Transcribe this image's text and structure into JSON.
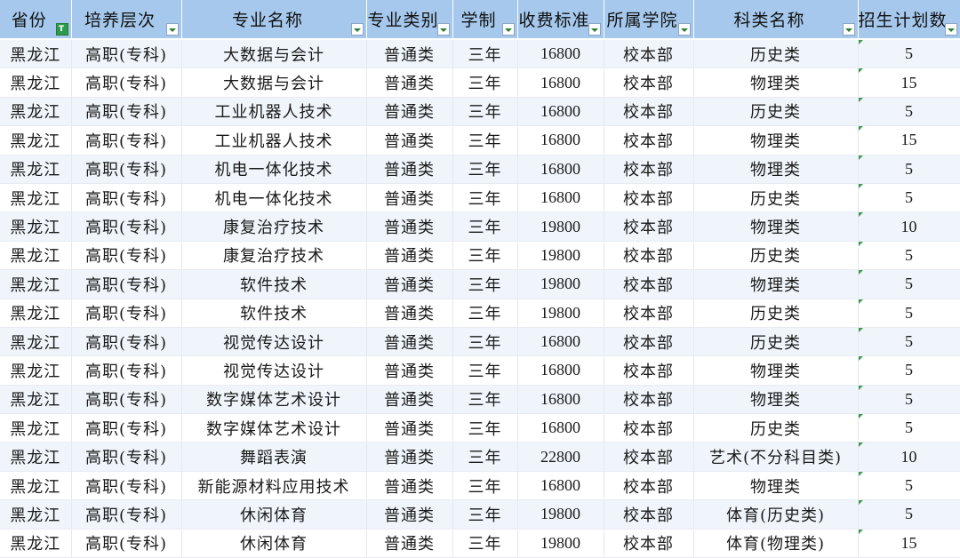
{
  "headers": [
    {
      "label": "省份",
      "filter": "active"
    },
    {
      "label": "培养层次",
      "filter": "dropdown"
    },
    {
      "label": "专业名称",
      "filter": "dropdown"
    },
    {
      "label": "专业类别",
      "filter": "dropdown"
    },
    {
      "label": "学制",
      "filter": "dropdown"
    },
    {
      "label": "收费标准",
      "filter": "dropdown"
    },
    {
      "label": "所属学院",
      "filter": "dropdown"
    },
    {
      "label": "科类名称",
      "filter": "dropdown"
    },
    {
      "label": "招生计划数",
      "filter": "dropdown"
    }
  ],
  "rows": [
    [
      "黑龙江",
      "高职(专科)",
      "大数据与会计",
      "普通类",
      "三年",
      "16800",
      "校本部",
      "历史类",
      "5"
    ],
    [
      "黑龙江",
      "高职(专科)",
      "大数据与会计",
      "普通类",
      "三年",
      "16800",
      "校本部",
      "物理类",
      "15"
    ],
    [
      "黑龙江",
      "高职(专科)",
      "工业机器人技术",
      "普通类",
      "三年",
      "16800",
      "校本部",
      "历史类",
      "5"
    ],
    [
      "黑龙江",
      "高职(专科)",
      "工业机器人技术",
      "普通类",
      "三年",
      "16800",
      "校本部",
      "物理类",
      "15"
    ],
    [
      "黑龙江",
      "高职(专科)",
      "机电一体化技术",
      "普通类",
      "三年",
      "16800",
      "校本部",
      "物理类",
      "5"
    ],
    [
      "黑龙江",
      "高职(专科)",
      "机电一体化技术",
      "普通类",
      "三年",
      "16800",
      "校本部",
      "历史类",
      "5"
    ],
    [
      "黑龙江",
      "高职(专科)",
      "康复治疗技术",
      "普通类",
      "三年",
      "19800",
      "校本部",
      "物理类",
      "10"
    ],
    [
      "黑龙江",
      "高职(专科)",
      "康复治疗技术",
      "普通类",
      "三年",
      "19800",
      "校本部",
      "历史类",
      "5"
    ],
    [
      "黑龙江",
      "高职(专科)",
      "软件技术",
      "普通类",
      "三年",
      "19800",
      "校本部",
      "物理类",
      "5"
    ],
    [
      "黑龙江",
      "高职(专科)",
      "软件技术",
      "普通类",
      "三年",
      "19800",
      "校本部",
      "历史类",
      "5"
    ],
    [
      "黑龙江",
      "高职(专科)",
      "视觉传达设计",
      "普通类",
      "三年",
      "16800",
      "校本部",
      "历史类",
      "5"
    ],
    [
      "黑龙江",
      "高职(专科)",
      "视觉传达设计",
      "普通类",
      "三年",
      "16800",
      "校本部",
      "物理类",
      "5"
    ],
    [
      "黑龙江",
      "高职(专科)",
      "数字媒体艺术设计",
      "普通类",
      "三年",
      "16800",
      "校本部",
      "物理类",
      "5"
    ],
    [
      "黑龙江",
      "高职(专科)",
      "数字媒体艺术设计",
      "普通类",
      "三年",
      "16800",
      "校本部",
      "历史类",
      "5"
    ],
    [
      "黑龙江",
      "高职(专科)",
      "舞蹈表演",
      "普通类",
      "三年",
      "22800",
      "校本部",
      "艺术(不分科目类)",
      "10"
    ],
    [
      "黑龙江",
      "高职(专科)",
      "新能源材料应用技术",
      "普通类",
      "三年",
      "16800",
      "校本部",
      "物理类",
      "5"
    ],
    [
      "黑龙江",
      "高职(专科)",
      "休闲体育",
      "普通类",
      "三年",
      "19800",
      "校本部",
      "体育(历史类)",
      "5"
    ],
    [
      "黑龙江",
      "高职(专科)",
      "休闲体育",
      "普通类",
      "三年",
      "19800",
      "校本部",
      "体育(物理类)",
      "15"
    ]
  ],
  "colors": {
    "header_bg": "#a5c8ec",
    "row_band": "#f0f5fb",
    "filter_active": "#2e9b4a",
    "cell_marker": "#3f9a4f"
  },
  "icons": {
    "active_filter": "funnel-icon",
    "dropdown_filter": "dropdown-arrow-icon"
  }
}
